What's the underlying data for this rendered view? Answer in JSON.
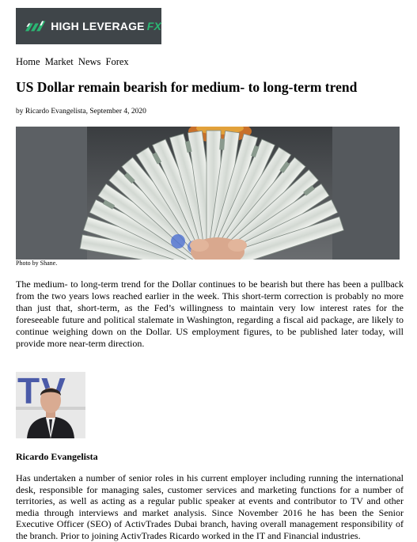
{
  "logo": {
    "text": "HIGH LEVERAGE",
    "suffix": "FX"
  },
  "nav": {
    "items": [
      "Home",
      "Market",
      "News",
      "Forex"
    ]
  },
  "article": {
    "title": "US Dollar remain bearish for medium- to long-term trend",
    "byline": "by Ricardo Evangelista, September 4, 2020",
    "photo_caption": "Photo by Shane.",
    "body": "The medium- to long-term trend for the Dollar continues to be bearish but there has been a pullback from the two years lows reached earlier in the week. This short-term correction is probably no more than just that, short-term, as the Fed’s willingness to maintain very low interest rates for the foreseeable future and political stalemate in Washington, regarding a fiscal aid package, are likely to continue weighing down on the Dollar. US employment figures, to be published later today, will provide more near-term direction."
  },
  "author": {
    "name": "Ricardo Evangelista",
    "photo_logo": "TV",
    "bio": "Has undertaken a number of senior roles in his current employer including running the international desk, responsible for managing sales, customer services and marketing functions for a number of territories, as well as acting as a regular public speaker at events and contributor to TV and other media through interviews and market analysis. Since November 2016 he has been the Senior Executive Officer (SEO) of ActivTrades Dubai branch, having overall management responsibility of the branch. Prior to joining ActivTrades Ricardo worked in the IT and Financial industries."
  },
  "colors": {
    "logo_bg": "#3f4549",
    "logo_accent": "#2bb673"
  }
}
